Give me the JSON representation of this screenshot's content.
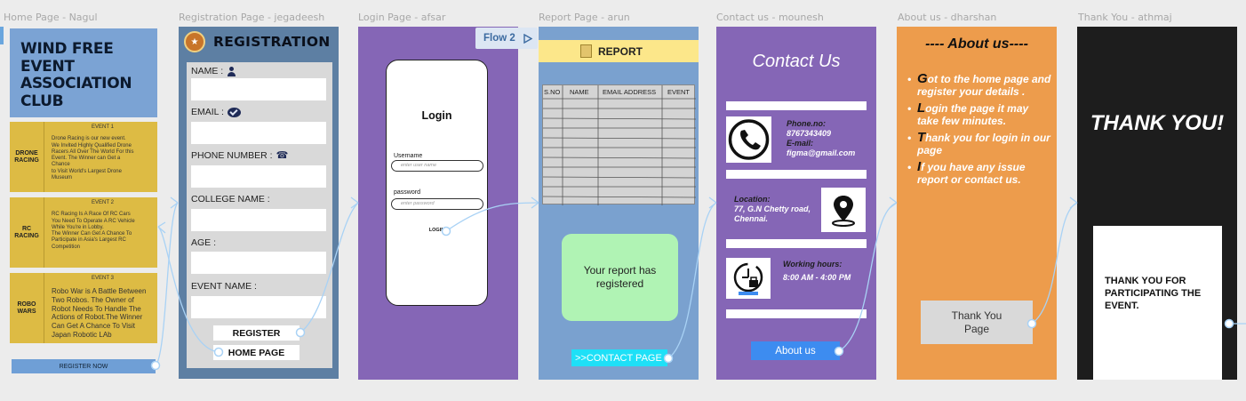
{
  "canvas": {
    "frame_labels": [
      "Home Page - Nagul",
      "Registration Page - jegadeesh",
      "Login Page - afsar",
      "Report Page - arun",
      "Contact us - mounesh",
      "About us - dharshan",
      "Thank You - athmaj"
    ],
    "flow_label": "Flow 2",
    "wire_color": "#a9d2f5"
  },
  "home": {
    "title_lines": [
      "WIND FREE",
      "EVENT",
      "ASSOCIATION",
      "CLUB"
    ],
    "events": [
      {
        "tag": "EVENT 1",
        "name_lines": [
          "DRONE",
          "RACING"
        ],
        "lines": [
          "Drone Racing is our new event.",
          "We Invited Highly Qualified Drone",
          "Racers All Over The World For this",
          "Event. The Winner can Get a",
          "Chance",
          "to Visit World's Largest Drone",
          "Museum"
        ]
      },
      {
        "tag": "EVENT 2",
        "name_lines": [
          "RC",
          "RACING"
        ],
        "lines": [
          "RC Racing Is A Race Of RC Cars",
          "You Need To Operate A RC Vehicle",
          "While You're in Lobby.",
          "The Winner Can Get A Chance To",
          "Participate in Asia's Largest RC",
          "Competition"
        ]
      },
      {
        "tag": "EVENT 3",
        "name_lines": [
          "ROBO",
          "WARS"
        ],
        "lines": [
          "Robo War is A Battle Between",
          "Two Robos. The Owner of",
          "Robot Needs To Handle The",
          "Actions of Robot.The Winner",
          "Can Get A Chance To Visit",
          "Japan Robotic LAb"
        ]
      }
    ],
    "register_now": "REGISTER NOW"
  },
  "registration": {
    "title": "REGISTRATION",
    "fields": {
      "name": "NAME :",
      "email": "EMAIL :",
      "phone": "PHONE NUMBER :",
      "college": "COLLEGE NAME :",
      "age": "AGE :",
      "event": "EVENT NAME :"
    },
    "register_button": "REGISTER",
    "home_button": "HOME PAGE"
  },
  "login": {
    "heading": "Login",
    "username_label": "Username",
    "username_placeholder": "enter user name",
    "password_label": "password",
    "password_placeholder": "enter password",
    "login_button": "LOGIN"
  },
  "report": {
    "title": "REPORT",
    "columns": [
      "S.NO",
      "NAME",
      "EMAIL ADDRESS",
      "EVENT"
    ],
    "success_message": "Your report has registered",
    "contact_button": ">>CONTACT PAGE"
  },
  "contact": {
    "title": "Contact Us",
    "phone_key": "Phone.no:",
    "phone_value": "8767343409",
    "email_key": "E-mail:",
    "email_value": "figma@gmail.com",
    "location_key": "Location:",
    "location_lines": [
      "77, G.N Chetty road,",
      "Chennai."
    ],
    "hours_key": "Working hours:",
    "hours_value": "8:00 AM - 4:00 PM",
    "about_button": "About us"
  },
  "about": {
    "title": "---- About us----",
    "steps": [
      {
        "cap": "G",
        "rest": "ot to the home page and register your details ."
      },
      {
        "cap": "L",
        "rest": "ogin the page it may take few minutes."
      },
      {
        "cap": "T",
        "rest": "hank you for login in our page"
      },
      {
        "cap": "I",
        "rest": "f you have any issue report or contact us."
      }
    ],
    "thank_button": "Thank You Page"
  },
  "thankyou": {
    "headline": "THANK YOU!",
    "message": "THANK YOU FOR PARTICIPATING THE EVENT."
  }
}
